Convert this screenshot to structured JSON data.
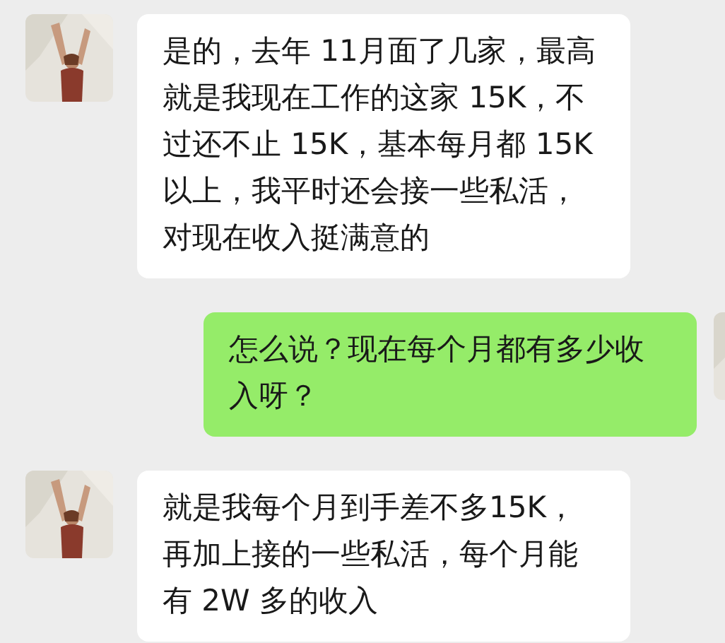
{
  "messages": [
    {
      "kind": "received",
      "text": "是的，去年 11月面了几家，最高就是我现在工作的这家 15K，不过还不止 15K，基本每月都 15K以上，我平时还会接一些私活，对现在收入挺满意的"
    },
    {
      "kind": "sent",
      "text": "怎么说？现在每个月都有多少收入呀？"
    },
    {
      "kind": "received",
      "text": "就是我每个月到手差不多15K，再加上接的一些私活，每个月能有 2W 多的收入"
    }
  ]
}
